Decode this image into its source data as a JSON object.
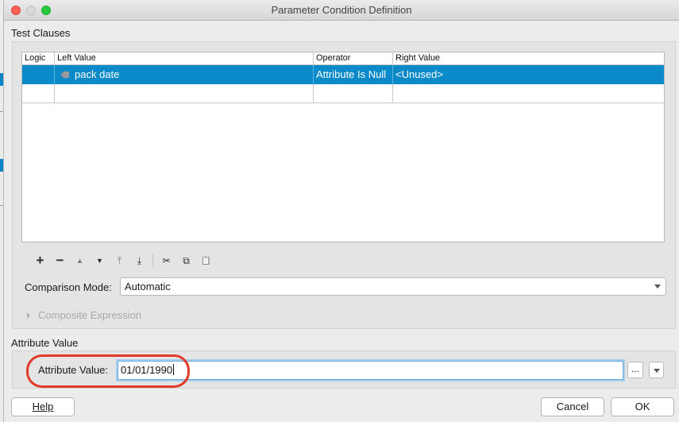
{
  "window": {
    "title": "Parameter Condition Definition"
  },
  "test_clauses": {
    "section_label": "Test Clauses",
    "columns": [
      "Logic",
      "Left Value",
      "Operator",
      "Right Value"
    ],
    "rows": [
      {
        "logic": "",
        "left_value": "pack date",
        "operator": "Attribute Is Null",
        "right_value": "<Unused>",
        "selected": true
      }
    ]
  },
  "toolbar": {
    "add": "+",
    "remove": "−",
    "move_up": "▲",
    "move_down": "▼",
    "move_top": "⤒",
    "move_bottom": "⤓",
    "cut": "✂",
    "copy": "⧉",
    "paste": "📋"
  },
  "comparison": {
    "label": "Comparison Mode:",
    "value": "Automatic"
  },
  "composite": {
    "label": "Composite Expression"
  },
  "attribute_value": {
    "section_label": "Attribute Value",
    "label": "Attribute Value:",
    "value": "01/01/1990",
    "ellipsis_label": "..."
  },
  "footer": {
    "help_label": "Help",
    "cancel_label": "Cancel",
    "ok_label": "OK"
  },
  "colors": {
    "selection": "#0a8ac8",
    "highlight_annotation": "#e23a2a"
  }
}
